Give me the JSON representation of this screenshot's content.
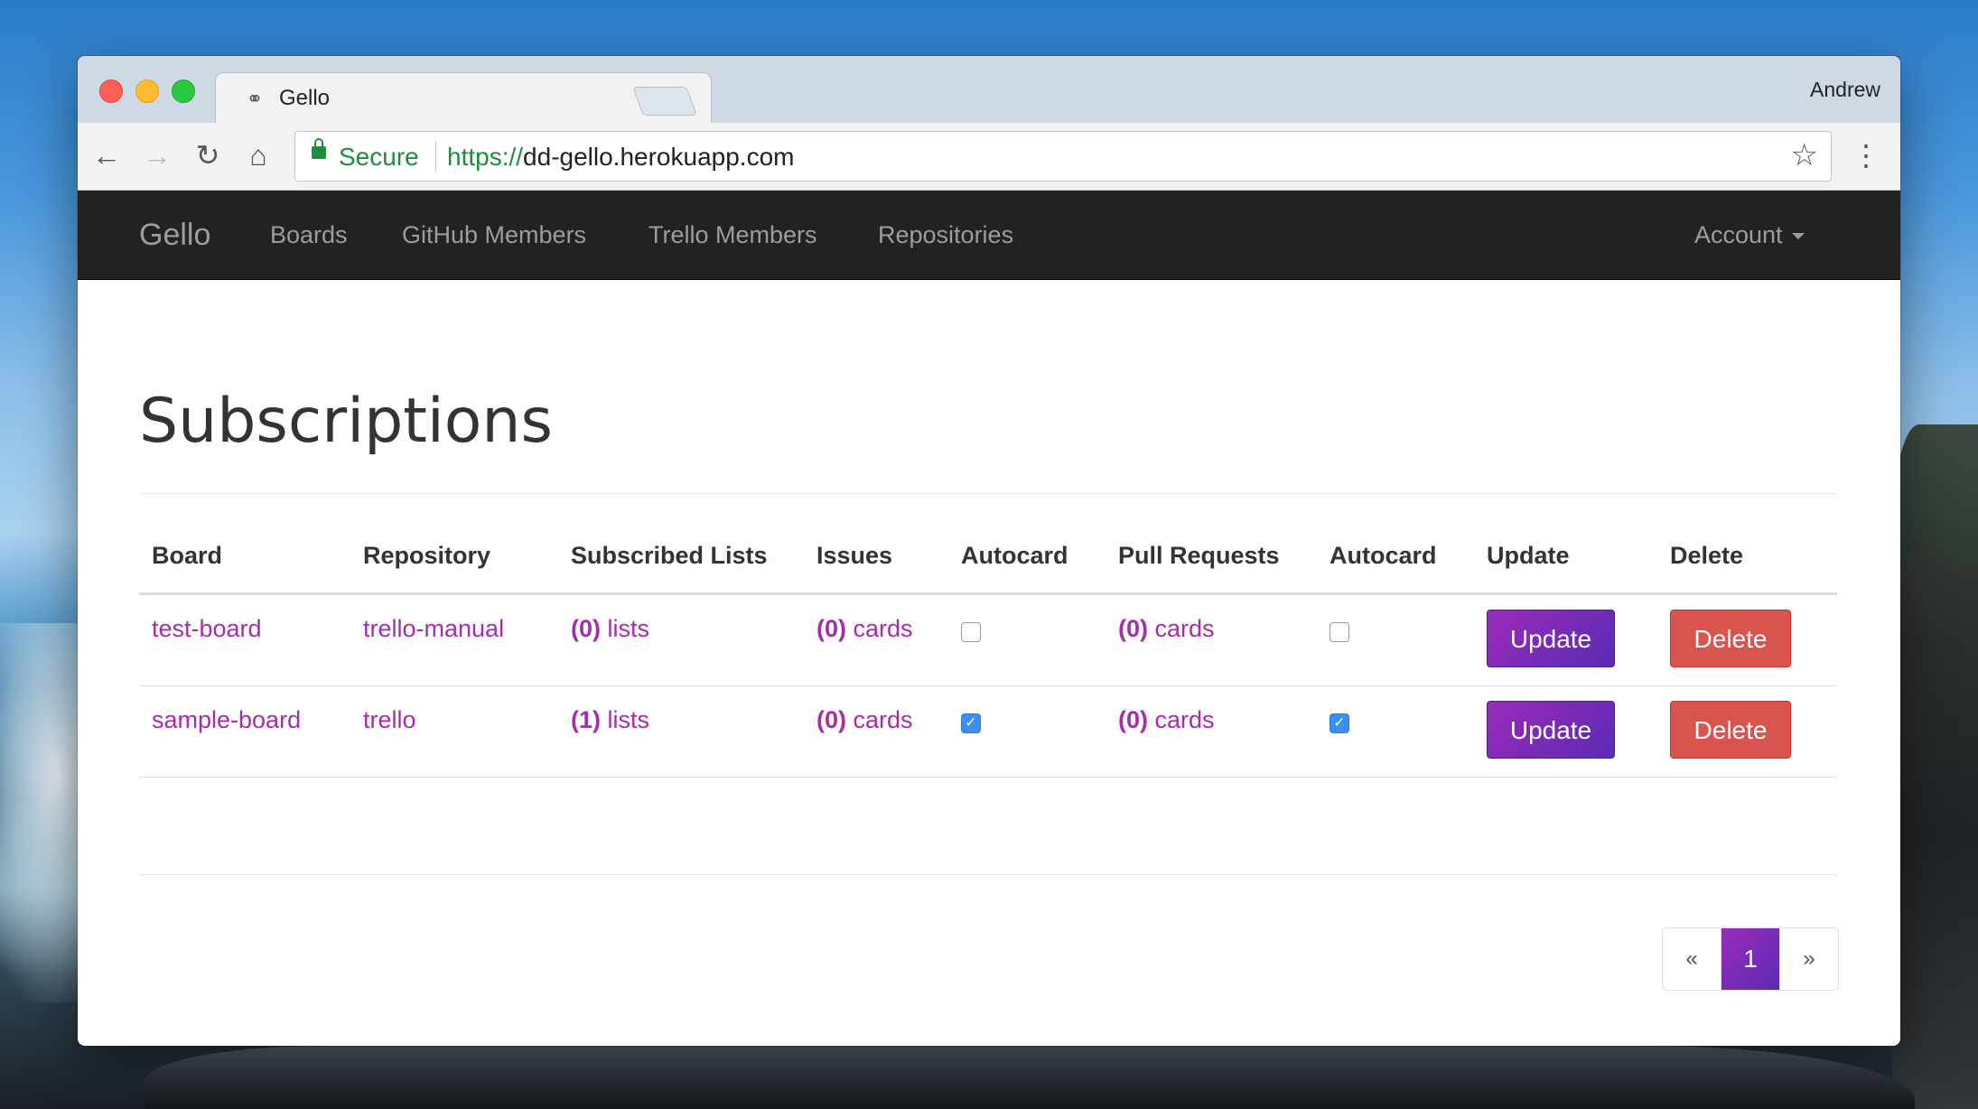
{
  "browser": {
    "tab_title": "Gello",
    "profile_name": "Andrew",
    "secure_label": "Secure",
    "url_scheme": "https://",
    "url_host": "dd-gello.herokuapp.com"
  },
  "navbar": {
    "brand": "Gello",
    "links": [
      "Boards",
      "GitHub Members",
      "Trello Members",
      "Repositories"
    ],
    "account": "Account"
  },
  "page": {
    "title": "Subscriptions"
  },
  "table": {
    "headers": [
      "Board",
      "Repository",
      "Subscribed Lists",
      "Issues",
      "Autocard",
      "Pull Requests",
      "Autocard",
      "Update",
      "Delete"
    ],
    "rows": [
      {
        "board": "test-board",
        "repository": "trello-manual",
        "lists_count": "(0)",
        "lists_label": " lists",
        "issues_count": "(0)",
        "issues_label": " cards",
        "issues_autocard": false,
        "pr_count": "(0)",
        "pr_label": " cards",
        "pr_autocard": false,
        "update_label": "Update",
        "delete_label": "Delete"
      },
      {
        "board": "sample-board",
        "repository": "trello",
        "lists_count": "(1)",
        "lists_label": " lists",
        "issues_count": "(0)",
        "issues_label": " cards",
        "issues_autocard": true,
        "pr_count": "(0)",
        "pr_label": " cards",
        "pr_autocard": true,
        "update_label": "Update",
        "delete_label": "Delete"
      }
    ]
  },
  "pagination": {
    "prev": "«",
    "current": "1",
    "next": "»"
  },
  "colors": {
    "accent": "#a72cad",
    "navbar_bg": "#222222",
    "delete_bg": "#d9534f",
    "checkbox_checked": "#3b8ff0"
  }
}
